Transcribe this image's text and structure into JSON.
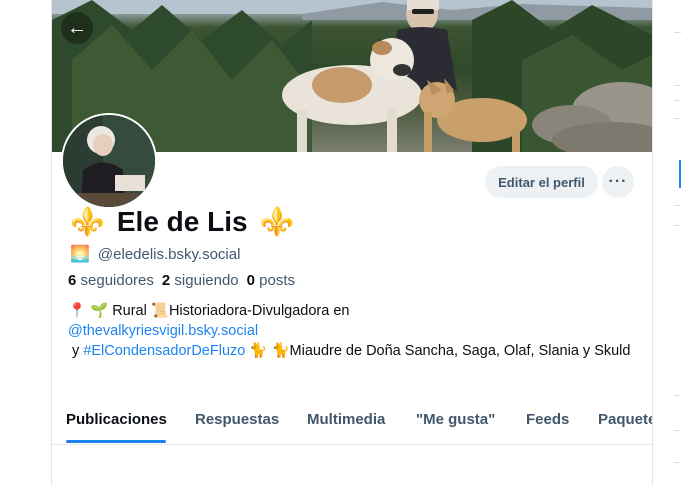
{
  "header": {
    "back_icon": "arrow-left-icon",
    "edit_profile_label": "Editar el perfil",
    "more_label": "···"
  },
  "profile": {
    "display_name": "Ele de Lis",
    "name_decor": "⚜️",
    "handle_emoji": "🌅",
    "handle": "@eledelis.bsky.social",
    "followers_count": "6",
    "followers_label": "seguidores",
    "following_count": "2",
    "following_label": "siguiendo",
    "posts_count": "0",
    "posts_label": "posts",
    "bio": {
      "pin": "📍",
      "sprout": "🌱",
      "rural": "Rural",
      "scroll": "📜",
      "line1_text": "Historiadora-Divulgadora en",
      "link1": "@thevalkyriesvigil.bsky.social",
      "y": "y",
      "link2": "#ElCondensadorDeFluzo",
      "cat1": "🐈",
      "cat2": "🐈",
      "rest": "Miaudre de Doña Sancha, Saga, Olaf, Slania y Skuld"
    }
  },
  "tabs": [
    {
      "label": "Publicaciones"
    },
    {
      "label": "Respuestas"
    },
    {
      "label": "Multimedia"
    },
    {
      "label": "\"Me gusta\""
    },
    {
      "label": "Feeds"
    },
    {
      "label": "Paquetes"
    }
  ],
  "colors": {
    "accent": "#1d83f0",
    "muted_text": "#42576c",
    "button_bg": "#eef1f4"
  }
}
